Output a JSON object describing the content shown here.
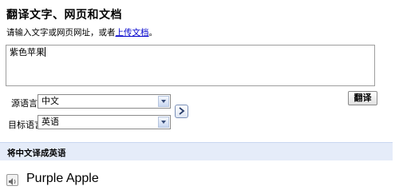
{
  "heading": "翻译文字、网页和文档",
  "instructions": {
    "prefix": "请输入文字或网页网址，或者",
    "link": "上传文档",
    "suffix": "。"
  },
  "source_text": "紫色苹果",
  "source_lang": {
    "label": "源语言：",
    "value": "中文"
  },
  "target_lang": {
    "label": "目标语言：",
    "value": "英语"
  },
  "swap_icon": "swap-arrow-icon",
  "translate_button": "翻译",
  "result_header": "将中文译成英语",
  "speaker_icon": "speaker-icon",
  "translation": "Purple Apple"
}
